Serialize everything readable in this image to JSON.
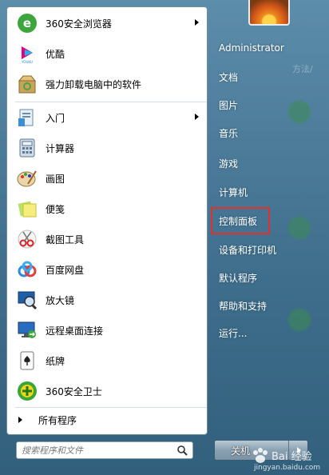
{
  "menu": {
    "pinned": [
      {
        "label": "360安全浏览器",
        "icon": "360-browser-icon",
        "has_submenu": true
      },
      {
        "label": "优酷",
        "icon": "youku-icon",
        "has_submenu": false
      },
      {
        "label": "强力卸载电脑中的软件",
        "icon": "uninstall-icon",
        "has_submenu": false
      }
    ],
    "recent": [
      {
        "label": "入门",
        "icon": "getting-started-icon",
        "has_submenu": true
      },
      {
        "label": "计算器",
        "icon": "calculator-icon",
        "has_submenu": false
      },
      {
        "label": "画图",
        "icon": "paint-icon",
        "has_submenu": false
      },
      {
        "label": "便笺",
        "icon": "sticky-notes-icon",
        "has_submenu": false
      },
      {
        "label": "截图工具",
        "icon": "snipping-tool-icon",
        "has_submenu": false
      },
      {
        "label": "百度网盘",
        "icon": "baidu-netdisk-icon",
        "has_submenu": false
      },
      {
        "label": "放大镜",
        "icon": "magnifier-icon",
        "has_submenu": false
      },
      {
        "label": "远程桌面连接",
        "icon": "remote-desktop-icon",
        "has_submenu": false
      },
      {
        "label": "纸牌",
        "icon": "solitaire-icon",
        "has_submenu": false
      },
      {
        "label": "360安全卫士",
        "icon": "360-security-icon",
        "has_submenu": false
      }
    ],
    "all_programs_label": "所有程序",
    "search_placeholder": "搜索程序和文件"
  },
  "right": {
    "user": "Administrator",
    "items": [
      {
        "label": "文档"
      },
      {
        "label": "图片"
      },
      {
        "label": "音乐"
      },
      {
        "label": "游戏"
      },
      {
        "label": "计算机"
      },
      {
        "label": "控制面板",
        "highlighted": true
      },
      {
        "label": "设备和打印机"
      },
      {
        "label": "默认程序"
      },
      {
        "label": "帮助和支持"
      },
      {
        "label": "运行..."
      }
    ],
    "shutdown_label": "关机"
  },
  "watermark": {
    "text": "Bai 经验",
    "sub": "jingyan.baidu.com"
  },
  "colors": {
    "highlight": "#e03030",
    "panel_bg": "#ffffff",
    "taskbar_text": "#ffffff"
  }
}
